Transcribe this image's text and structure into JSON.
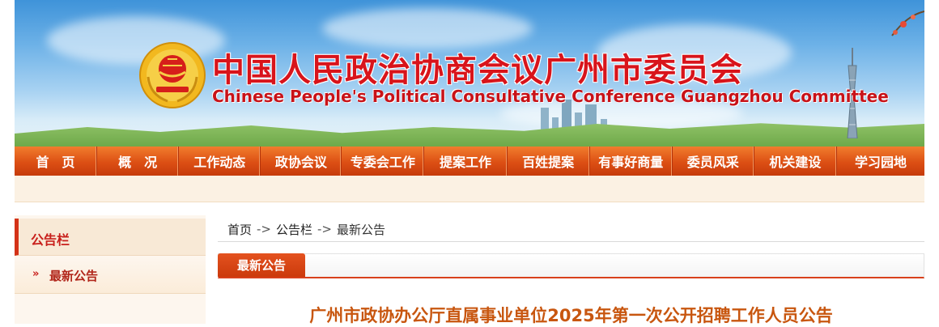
{
  "header": {
    "title_cn": "中国人民政治协商会议广州市委员会",
    "title_en": "Chinese People's Political Consultative Conference Guangzhou Committee",
    "emblem_icon": "cppcc-emblem-icon",
    "colors": {
      "title": "#d8141b",
      "nav": "#dc4f14",
      "accent": "#c8201c"
    }
  },
  "nav": {
    "items": [
      {
        "label": "首　页"
      },
      {
        "label": "概　况"
      },
      {
        "label": "工作动态"
      },
      {
        "label": "政协会议"
      },
      {
        "label": "专委会工作"
      },
      {
        "label": "提案工作"
      },
      {
        "label": "百姓提案"
      },
      {
        "label": "有事好商量"
      },
      {
        "label": "委员风采"
      },
      {
        "label": "机关建设"
      },
      {
        "label": "学习园地"
      }
    ]
  },
  "sidebar": {
    "heading": "公告栏",
    "items": [
      {
        "label": "最新公告",
        "icon": "double-chevron-right-icon"
      }
    ]
  },
  "breadcrumb": {
    "items": [
      "首页",
      "公告栏",
      "最新公告"
    ],
    "separator": "->"
  },
  "section": {
    "tab_label": "最新公告"
  },
  "article": {
    "title": "广州市政协办公厅直属事业单位2025年第一次公开招聘工作人员公告"
  }
}
